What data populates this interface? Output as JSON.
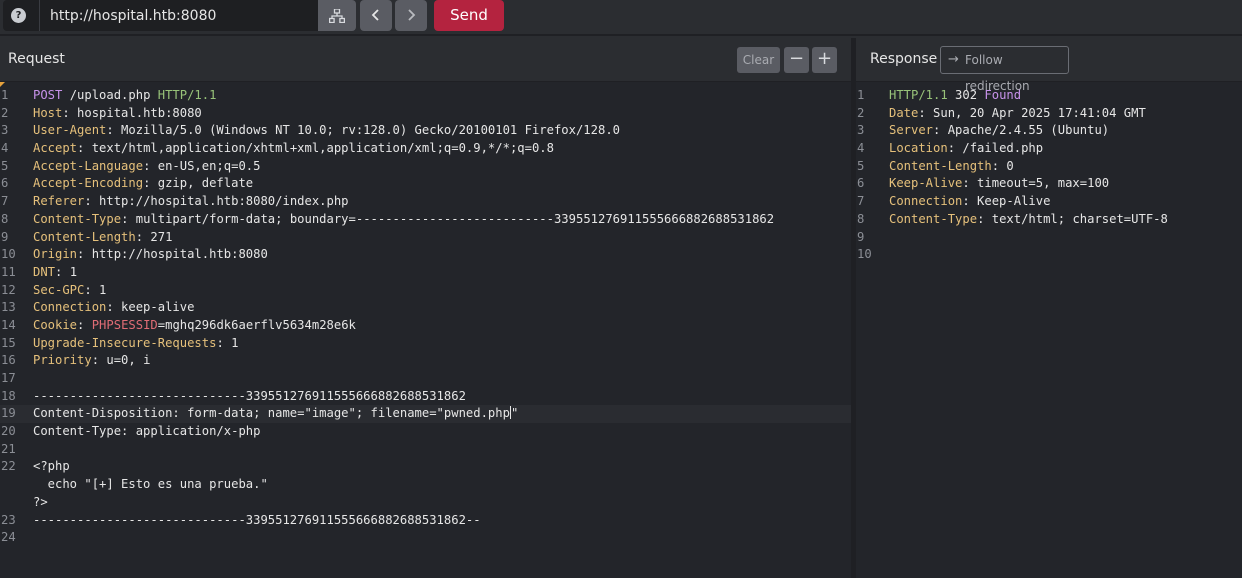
{
  "toolbar": {
    "help_icon": "?",
    "url_value": "http://hospital.htb:8080",
    "send_label": "Send"
  },
  "request": {
    "title": "Request",
    "clear_label": "Clear",
    "minus_label": "−",
    "plus_label": "+",
    "lines": [
      {
        "n": "1",
        "parts": [
          {
            "t": "POST",
            "c": "p"
          },
          {
            "t": " /upload.php ",
            "c": ""
          },
          {
            "t": "HTTP/1.1",
            "c": "g"
          }
        ]
      },
      {
        "n": "2",
        "parts": [
          {
            "t": "Host",
            "c": "k"
          },
          {
            "t": ": hospital.htb:8080",
            "c": ""
          }
        ]
      },
      {
        "n": "3",
        "parts": [
          {
            "t": "User-Agent",
            "c": "k"
          },
          {
            "t": ": Mozilla/5.0 (Windows NT 10.0; rv:128.0) Gecko/20100101 Firefox/128.0",
            "c": ""
          }
        ]
      },
      {
        "n": "4",
        "parts": [
          {
            "t": "Accept",
            "c": "k"
          },
          {
            "t": ": text/html,application/xhtml+xml,application/xml;q=0.9,*/*;q=0.8",
            "c": ""
          }
        ]
      },
      {
        "n": "5",
        "parts": [
          {
            "t": "Accept-Language",
            "c": "k"
          },
          {
            "t": ": en-US,en;q=0.5",
            "c": ""
          }
        ]
      },
      {
        "n": "6",
        "parts": [
          {
            "t": "Accept-Encoding",
            "c": "k"
          },
          {
            "t": ": gzip, deflate",
            "c": ""
          }
        ]
      },
      {
        "n": "7",
        "parts": [
          {
            "t": "Referer",
            "c": "k"
          },
          {
            "t": ": http://hospital.htb:8080/index.php",
            "c": ""
          }
        ]
      },
      {
        "n": "8",
        "parts": [
          {
            "t": "Content-Type",
            "c": "k"
          },
          {
            "t": ": multipart/form-data; boundary=---------------------------339551276911555666882688531862",
            "c": ""
          }
        ]
      },
      {
        "n": "9",
        "parts": [
          {
            "t": "Content-Length",
            "c": "k"
          },
          {
            "t": ": 271",
            "c": ""
          }
        ]
      },
      {
        "n": "10",
        "parts": [
          {
            "t": "Origin",
            "c": "k"
          },
          {
            "t": ": http://hospital.htb:8080",
            "c": ""
          }
        ]
      },
      {
        "n": "11",
        "parts": [
          {
            "t": "DNT",
            "c": "k"
          },
          {
            "t": ": 1",
            "c": ""
          }
        ]
      },
      {
        "n": "12",
        "parts": [
          {
            "t": "Sec-GPC",
            "c": "k"
          },
          {
            "t": ": 1",
            "c": ""
          }
        ]
      },
      {
        "n": "13",
        "parts": [
          {
            "t": "Connection",
            "c": "k"
          },
          {
            "t": ": keep-alive",
            "c": ""
          }
        ]
      },
      {
        "n": "14",
        "parts": [
          {
            "t": "Cookie",
            "c": "k"
          },
          {
            "t": ": ",
            "c": ""
          },
          {
            "t": "PHPSESSID",
            "c": "r"
          },
          {
            "t": "=mghq296dk6aerflv5634m28e6k",
            "c": ""
          }
        ]
      },
      {
        "n": "15",
        "parts": [
          {
            "t": "Upgrade-Insecure-Requests",
            "c": "k"
          },
          {
            "t": ": 1",
            "c": ""
          }
        ]
      },
      {
        "n": "16",
        "parts": [
          {
            "t": "Priority",
            "c": "k"
          },
          {
            "t": ": u=0, i",
            "c": ""
          }
        ]
      },
      {
        "n": "17",
        "parts": []
      },
      {
        "n": "18",
        "parts": [
          {
            "t": "-----------------------------339551276911555666882688531862",
            "c": ""
          }
        ]
      },
      {
        "n": "19",
        "active": true,
        "parts": [
          {
            "t": "Content-Disposition: form-data; name=\"image\"; filename=\"pwned.php",
            "c": ""
          },
          {
            "t": "CARET",
            "c": "caret"
          },
          {
            "t": "\"",
            "c": ""
          }
        ]
      },
      {
        "n": "20",
        "parts": [
          {
            "t": "Content-Type: application/x-php",
            "c": ""
          }
        ]
      },
      {
        "n": "21",
        "parts": []
      },
      {
        "n": "22",
        "parts": [
          {
            "t": "<?php",
            "c": ""
          }
        ]
      },
      {
        "n": "",
        "parts": [
          {
            "t": "  echo \"[+] Esto es una prueba.\"",
            "c": ""
          }
        ]
      },
      {
        "n": "",
        "parts": [
          {
            "t": "?>",
            "c": ""
          }
        ]
      },
      {
        "n": "23",
        "parts": [
          {
            "t": "-----------------------------339551276911555666882688531862--",
            "c": ""
          }
        ]
      },
      {
        "n": "24",
        "parts": []
      }
    ]
  },
  "response": {
    "title": "Response",
    "follow_label": "Follow redirection",
    "lines": [
      {
        "n": "1",
        "parts": [
          {
            "t": "HTTP/1.1",
            "c": "g"
          },
          {
            "t": " 302 ",
            "c": ""
          },
          {
            "t": "Found",
            "c": "p"
          }
        ]
      },
      {
        "n": "2",
        "parts": [
          {
            "t": "Date",
            "c": "k"
          },
          {
            "t": ": Sun, 20 Apr 2025 17:41:04 GMT",
            "c": ""
          }
        ]
      },
      {
        "n": "3",
        "parts": [
          {
            "t": "Server",
            "c": "k"
          },
          {
            "t": ": Apache/2.4.55 (Ubuntu)",
            "c": ""
          }
        ]
      },
      {
        "n": "4",
        "parts": [
          {
            "t": "Location",
            "c": "k"
          },
          {
            "t": ": /failed.php",
            "c": ""
          }
        ]
      },
      {
        "n": "5",
        "parts": [
          {
            "t": "Content-Length",
            "c": "k"
          },
          {
            "t": ": 0",
            "c": ""
          }
        ]
      },
      {
        "n": "6",
        "parts": [
          {
            "t": "Keep-Alive",
            "c": "k"
          },
          {
            "t": ": timeout=5, max=100",
            "c": ""
          }
        ]
      },
      {
        "n": "7",
        "parts": [
          {
            "t": "Connection",
            "c": "k"
          },
          {
            "t": ": Keep-Alive",
            "c": ""
          }
        ]
      },
      {
        "n": "8",
        "parts": [
          {
            "t": "Content-Type",
            "c": "k"
          },
          {
            "t": ": text/html; charset=UTF-8",
            "c": ""
          }
        ]
      },
      {
        "n": "9",
        "parts": []
      },
      {
        "n": "10",
        "parts": []
      }
    ]
  }
}
